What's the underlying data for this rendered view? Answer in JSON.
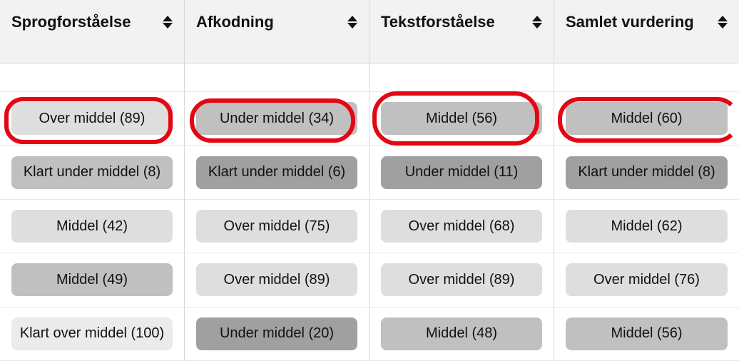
{
  "columns": [
    {
      "header": "Sprogforståelse",
      "rows": [
        {
          "label": "Over middel (89)",
          "shade": "light"
        },
        {
          "label": "Klart under middel (8)",
          "shade": "mid"
        },
        {
          "label": "Middel (42)",
          "shade": "light"
        },
        {
          "label": "Middel (49)",
          "shade": "mid"
        },
        {
          "label": "Klart over middel (100)",
          "shade": "xlight"
        }
      ]
    },
    {
      "header": "Afkodning",
      "rows": [
        {
          "label": "Under middel (34)",
          "shade": "mid"
        },
        {
          "label": "Klart under middel (6)",
          "shade": "dark"
        },
        {
          "label": "Over middel (75)",
          "shade": "light"
        },
        {
          "label": "Over middel (89)",
          "shade": "light"
        },
        {
          "label": "Under middel (20)",
          "shade": "dark"
        }
      ]
    },
    {
      "header": "Tekstforståelse",
      "rows": [
        {
          "label": "Middel (56)",
          "shade": "mid"
        },
        {
          "label": "Under middel (11)",
          "shade": "dark"
        },
        {
          "label": "Over middel (68)",
          "shade": "light"
        },
        {
          "label": "Over middel (89)",
          "shade": "light"
        },
        {
          "label": "Middel (48)",
          "shade": "mid"
        }
      ]
    },
    {
      "header": "Samlet vurdering",
      "rows": [
        {
          "label": "Middel (60)",
          "shade": "mid"
        },
        {
          "label": "Klart under middel (8)",
          "shade": "dark"
        },
        {
          "label": "Middel (62)",
          "shade": "light"
        },
        {
          "label": "Over middel (76)",
          "shade": "light"
        },
        {
          "label": "Middel (56)",
          "shade": "mid"
        }
      ]
    }
  ]
}
